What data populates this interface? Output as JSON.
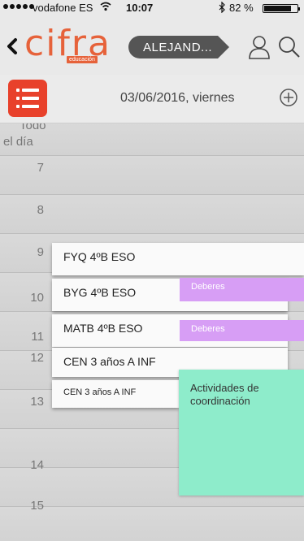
{
  "status_bar": {
    "carrier": "vodafone ES",
    "wifi_icon": "wifi-icon",
    "time": "10:07",
    "bluetooth_icon": "bluetooth-icon",
    "battery_percent": "82 %",
    "battery_level": 0.82
  },
  "header": {
    "back_icon": "chevron-left-icon",
    "logo": {
      "word": "cifra",
      "tag": "educación",
      "color": "#e6623a"
    },
    "user_name": "ALEJAND...",
    "pill_color": "#555555",
    "profile_icon": "user-icon",
    "search_icon": "search-icon"
  },
  "date_bar": {
    "menu_icon": "list-menu-icon",
    "menu_color": "#e8412b",
    "date": "03/06/2016, viernes",
    "add_icon": "plus-circle-icon"
  },
  "calendar": {
    "all_day_label_a": "Todo",
    "all_day_label_b": "el día",
    "hours": [
      "7",
      "8",
      "9",
      "10",
      "11",
      "12",
      "13",
      "14",
      "15"
    ],
    "events": [
      {
        "title": "FYQ 4ºB ESO"
      },
      {
        "title": "BYG 4ºB ESO"
      },
      {
        "title": "MATB 4ºB ESO"
      },
      {
        "title": "CEN 3 años A INF"
      },
      {
        "title": "CEN 3 años A INF"
      }
    ],
    "tasks": [
      {
        "title": "Deberes",
        "color": "#d79ef5"
      },
      {
        "title": "Deberes",
        "color": "#d79ef5"
      }
    ],
    "activity": {
      "title_line1": "Actividades de",
      "title_line2": "coordinación",
      "color": "#8eeccb"
    }
  }
}
